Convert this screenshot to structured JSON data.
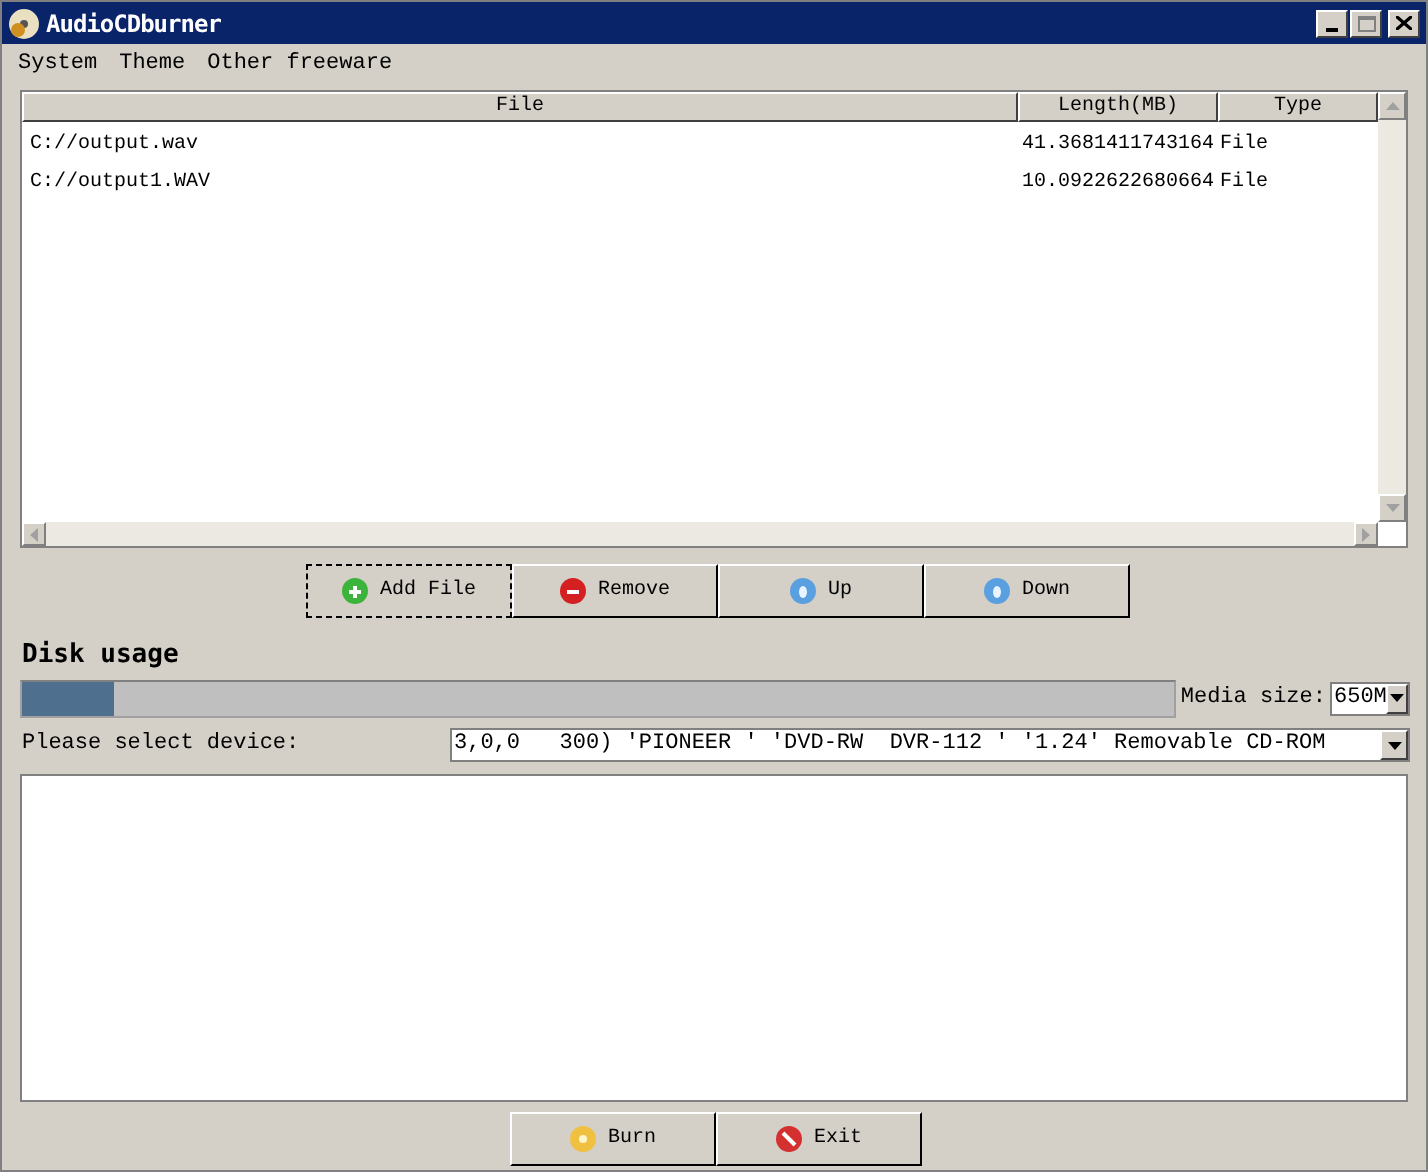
{
  "window": {
    "title": "AudioCDburner"
  },
  "menu": [
    "System",
    "Theme",
    "Other freeware"
  ],
  "file_list": {
    "columns": [
      "File",
      "Length(MB)",
      "Type"
    ],
    "rows": [
      [
        "C://output.wav",
        "41.3681411743164",
        "File"
      ],
      [
        "C://output1.WAV",
        "10.0922622680664",
        "File"
      ]
    ]
  },
  "list_buttons": [
    {
      "label": "Add File",
      "kind": "add",
      "focused": true
    },
    {
      "label": "Remove",
      "kind": "remove",
      "focused": false
    },
    {
      "label": "Up",
      "kind": "up",
      "focused": false
    },
    {
      "label": "Down",
      "kind": "down",
      "focused": false
    }
  ],
  "disk_usage": {
    "title": "Disk usage",
    "level": 0.08
  },
  "media_size": {
    "label": "Media size:",
    "value": "650M"
  },
  "device": {
    "label": "Please select device:",
    "value": "3,0,0   300) 'PIONEER ' 'DVD-RW  DVR-112 ' '1.24' Removable CD-ROM"
  },
  "bottom_buttons": [
    {
      "label": "Burn",
      "kind": "burn"
    },
    {
      "label": "Exit",
      "kind": "exit"
    }
  ]
}
